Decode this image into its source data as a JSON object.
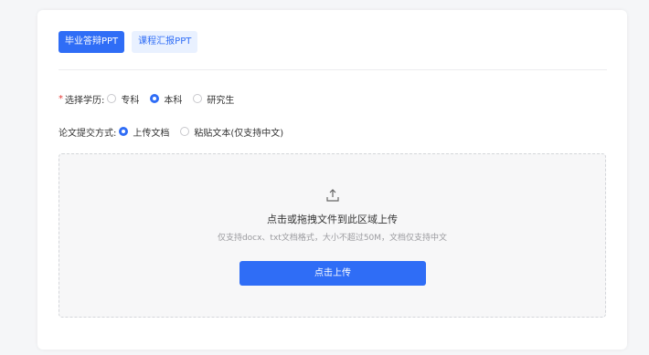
{
  "tabs": [
    {
      "label": "毕业答辩PPT",
      "active": true
    },
    {
      "label": "课程汇报PPT",
      "active": false
    }
  ],
  "education": {
    "required_mark": "*",
    "label": "选择学历:",
    "options": [
      {
        "label": "专科",
        "checked": false
      },
      {
        "label": "本科",
        "checked": true
      },
      {
        "label": "研究生",
        "checked": false
      }
    ]
  },
  "submission": {
    "label": "论文提交方式:",
    "options": [
      {
        "label": "上传文档",
        "checked": true
      },
      {
        "label": "粘贴文本(仅支持中文)",
        "checked": false
      }
    ]
  },
  "upload": {
    "icon": "upload-icon",
    "title": "点击或拖拽文件到此区域上传",
    "hint": "仅支持docx、txt文档格式，大小不超过50M，文档仅支持中文",
    "button_label": "点击上传"
  },
  "colors": {
    "accent": "#2f6df6",
    "required": "#e53935",
    "zone_bg": "#f7f7f8"
  }
}
